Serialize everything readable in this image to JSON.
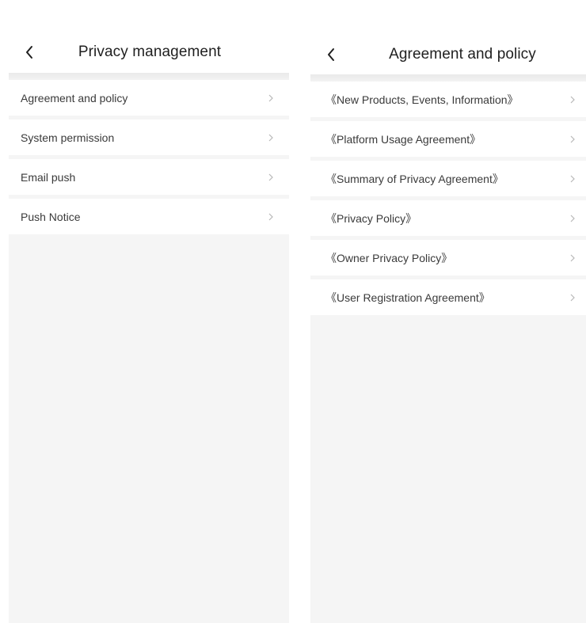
{
  "left_screen": {
    "title": "Privacy management",
    "items": [
      {
        "label": "Agreement and policy"
      },
      {
        "label": "System permission"
      },
      {
        "label": "Email push"
      },
      {
        "label": "Push Notice"
      }
    ]
  },
  "right_screen": {
    "title": "Agreement and policy",
    "items": [
      {
        "label": "《New Products, Events, Information》"
      },
      {
        "label": "《Platform Usage Agreement》"
      },
      {
        "label": "《Summary of Privacy Agreement》"
      },
      {
        "label": "《Privacy Policy》"
      },
      {
        "label": "《Owner Privacy Policy》"
      },
      {
        "label": "《User Registration Agreement》"
      }
    ]
  },
  "icons": {
    "back": "chevron-left-icon",
    "row_arrow": "chevron-right-icon"
  },
  "colors": {
    "background": "#f5f5f5",
    "row": "#ffffff",
    "text": "#3a3a3a",
    "title": "#1f1f1f",
    "chevron": "#b8b8b8"
  }
}
